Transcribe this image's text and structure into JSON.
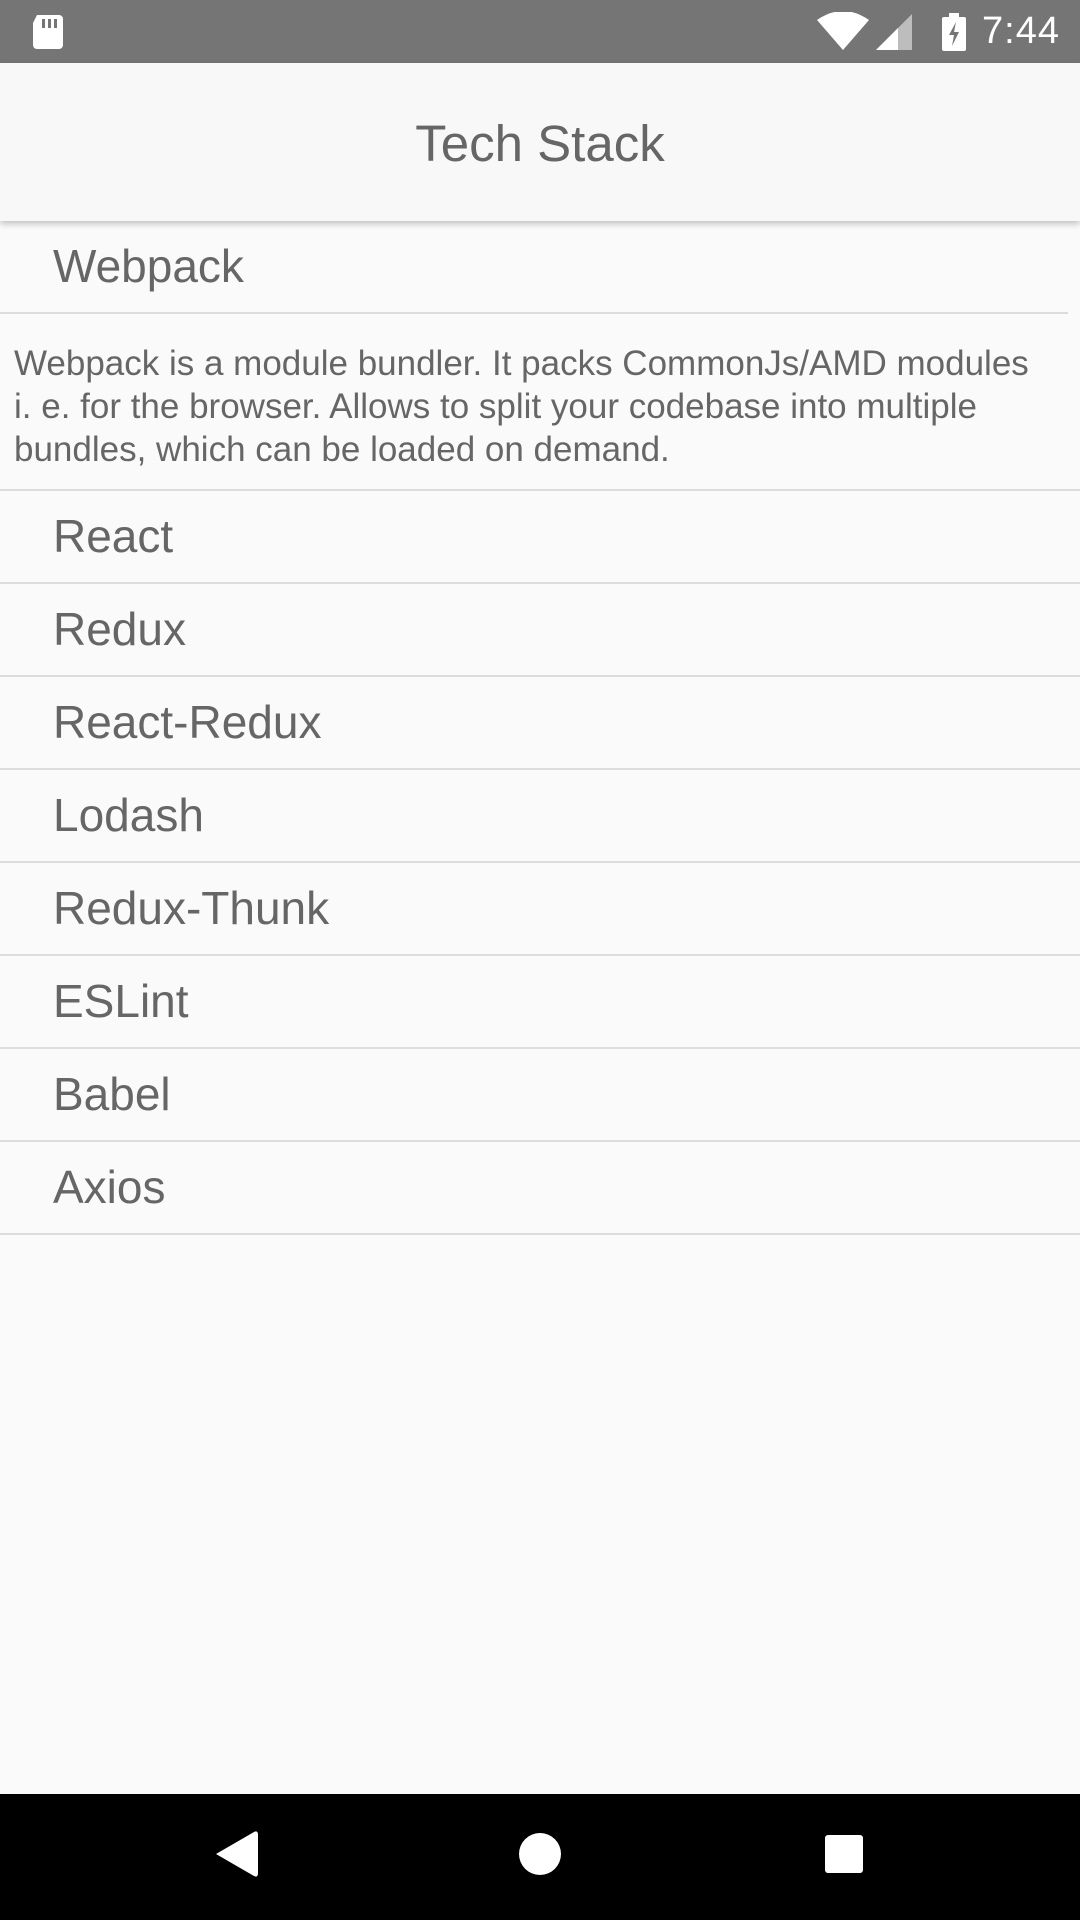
{
  "status_bar": {
    "time": "7:44",
    "icons": [
      "sd-card-icon",
      "wifi-icon",
      "signal-icon",
      "battery-charging-icon"
    ],
    "background": "#757575"
  },
  "app_bar": {
    "title": "Tech Stack"
  },
  "list": {
    "items": [
      {
        "title": "Webpack",
        "expanded": true,
        "description": "Webpack is a module bundler. It packs CommonJs/AMD modules i. e. for the browser. Allows to split your codebase into multiple bundles, which can be loaded on demand."
      },
      {
        "title": "React",
        "expanded": false
      },
      {
        "title": "Redux",
        "expanded": false
      },
      {
        "title": "React-Redux",
        "expanded": false
      },
      {
        "title": "Lodash",
        "expanded": false
      },
      {
        "title": "Redux-Thunk",
        "expanded": false
      },
      {
        "title": "ESLint",
        "expanded": false
      },
      {
        "title": "Babel",
        "expanded": false
      },
      {
        "title": "Axios",
        "expanded": false
      }
    ]
  },
  "nav_bar": {
    "buttons": [
      "back-icon",
      "home-icon",
      "recents-icon"
    ]
  },
  "colors": {
    "text": "#666666",
    "divider": "#dcdcdc",
    "background": "#fafafa",
    "status_bar": "#757575",
    "nav_bar": "#000000"
  }
}
